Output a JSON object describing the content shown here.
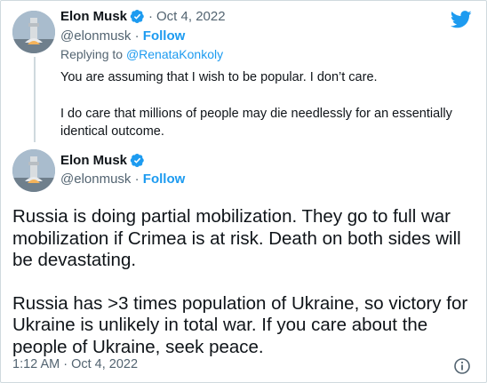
{
  "parent_tweet": {
    "author_name": "Elon Musk",
    "separator": "·",
    "date": "Oct 4, 2022",
    "handle": "@elonmusk",
    "handle_sep": " · ",
    "follow_label": "Follow",
    "replying_prefix": "Replying to ",
    "replying_to": "@RenataKonkoly",
    "paragraph_1": "You are assuming that I wish to be popular. I don’t care.",
    "paragraph_2": "I do care that millions of people may die needlessly for an essentially identical outcome."
  },
  "main_tweet": {
    "author_name": "Elon Musk",
    "handle": "@elonmusk",
    "handle_sep": " · ",
    "follow_label": "Follow",
    "paragraph_1": "Russia is doing partial mobilization. They go to full war mobilization if Crimea is at risk. Death on both sides will be devastating.",
    "paragraph_2": "Russia has >3 times population of Ukraine, so victory for Ukraine is unlikely in total war. If you care about the people of Ukraine, seek peace.",
    "timestamp": "1:12 AM · Oct 4, 2022"
  },
  "colors": {
    "accent": "#1d9bf0",
    "text": "#0f1419",
    "secondary": "#536471",
    "border": "#cfd9de"
  },
  "icons": {
    "logo": "twitter-bird-icon",
    "verified": "verified-badge-icon",
    "info": "info-icon"
  }
}
